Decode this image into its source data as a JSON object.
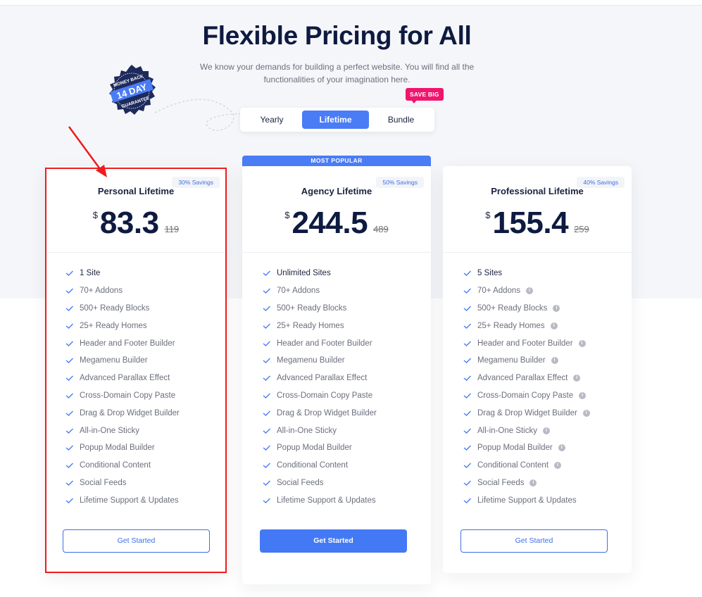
{
  "header": {
    "title": "Flexible Pricing for All",
    "subtitle": "We know your demands for building a perfect website. You will find all the functionalities of your imagination here."
  },
  "badge": {
    "top_text": "MONEY BACK",
    "center_text": "14 DAY",
    "bottom_text": "GUARANTEE"
  },
  "toggle": {
    "options": [
      "Yearly",
      "Lifetime",
      "Bundle"
    ],
    "selected": "Lifetime",
    "promo_label": "SAVE BIG"
  },
  "accent_color": "#4a7cf6",
  "plans": [
    {
      "name": "Personal Lifetime",
      "savings": "30% Savings",
      "currency": "$",
      "price": "83.3",
      "old_price": "119",
      "highlighted": true,
      "popular": false,
      "button": "Get Started",
      "features": [
        {
          "label": "1 Site",
          "info": false
        },
        {
          "label": "70+ Addons",
          "info": false
        },
        {
          "label": "500+ Ready Blocks",
          "info": false
        },
        {
          "label": "25+ Ready Homes",
          "info": false
        },
        {
          "label": "Header and Footer Builder",
          "info": false
        },
        {
          "label": "Megamenu Builder",
          "info": false
        },
        {
          "label": "Advanced Parallax Effect",
          "info": false
        },
        {
          "label": "Cross-Domain Copy Paste",
          "info": false
        },
        {
          "label": "Drag & Drop Widget Builder",
          "info": false
        },
        {
          "label": "All-in-One Sticky",
          "info": false
        },
        {
          "label": "Popup Modal Builder",
          "info": false
        },
        {
          "label": "Conditional Content",
          "info": false
        },
        {
          "label": "Social Feeds",
          "info": false
        },
        {
          "label": "Lifetime Support & Updates",
          "info": false
        }
      ]
    },
    {
      "name": "Agency Lifetime",
      "savings": "50% Savings",
      "currency": "$",
      "price": "244.5",
      "old_price": "489",
      "highlighted": false,
      "popular": true,
      "popular_label": "MOST POPULAR",
      "button": "Get Started",
      "features": [
        {
          "label": "Unlimited Sites",
          "info": false
        },
        {
          "label": "70+ Addons",
          "info": false
        },
        {
          "label": "500+ Ready Blocks",
          "info": false
        },
        {
          "label": "25+ Ready Homes",
          "info": false
        },
        {
          "label": "Header and Footer Builder",
          "info": false
        },
        {
          "label": "Megamenu Builder",
          "info": false
        },
        {
          "label": "Advanced Parallax Effect",
          "info": false
        },
        {
          "label": "Cross-Domain Copy Paste",
          "info": false
        },
        {
          "label": "Drag & Drop Widget Builder",
          "info": false
        },
        {
          "label": "All-in-One Sticky",
          "info": false
        },
        {
          "label": "Popup Modal Builder",
          "info": false
        },
        {
          "label": "Conditional Content",
          "info": false
        },
        {
          "label": "Social Feeds",
          "info": false
        },
        {
          "label": "Lifetime Support & Updates",
          "info": false
        }
      ]
    },
    {
      "name": "Professional Lifetime",
      "savings": "40% Savings",
      "currency": "$",
      "price": "155.4",
      "old_price": "259",
      "highlighted": false,
      "popular": false,
      "button": "Get Started",
      "features": [
        {
          "label": "5 Sites",
          "info": false
        },
        {
          "label": "70+ Addons",
          "info": true
        },
        {
          "label": "500+ Ready Blocks",
          "info": true
        },
        {
          "label": "25+ Ready Homes",
          "info": true
        },
        {
          "label": "Header and Footer Builder",
          "info": true
        },
        {
          "label": "Megamenu Builder",
          "info": true
        },
        {
          "label": "Advanced Parallax Effect",
          "info": true
        },
        {
          "label": "Cross-Domain Copy Paste",
          "info": true
        },
        {
          "label": "Drag & Drop Widget Builder",
          "info": true
        },
        {
          "label": "All-in-One Sticky",
          "info": true
        },
        {
          "label": "Popup Modal Builder",
          "info": true
        },
        {
          "label": "Conditional Content",
          "info": true
        },
        {
          "label": "Social Feeds",
          "info": true
        },
        {
          "label": "Lifetime Support & Updates",
          "info": false
        }
      ]
    }
  ]
}
